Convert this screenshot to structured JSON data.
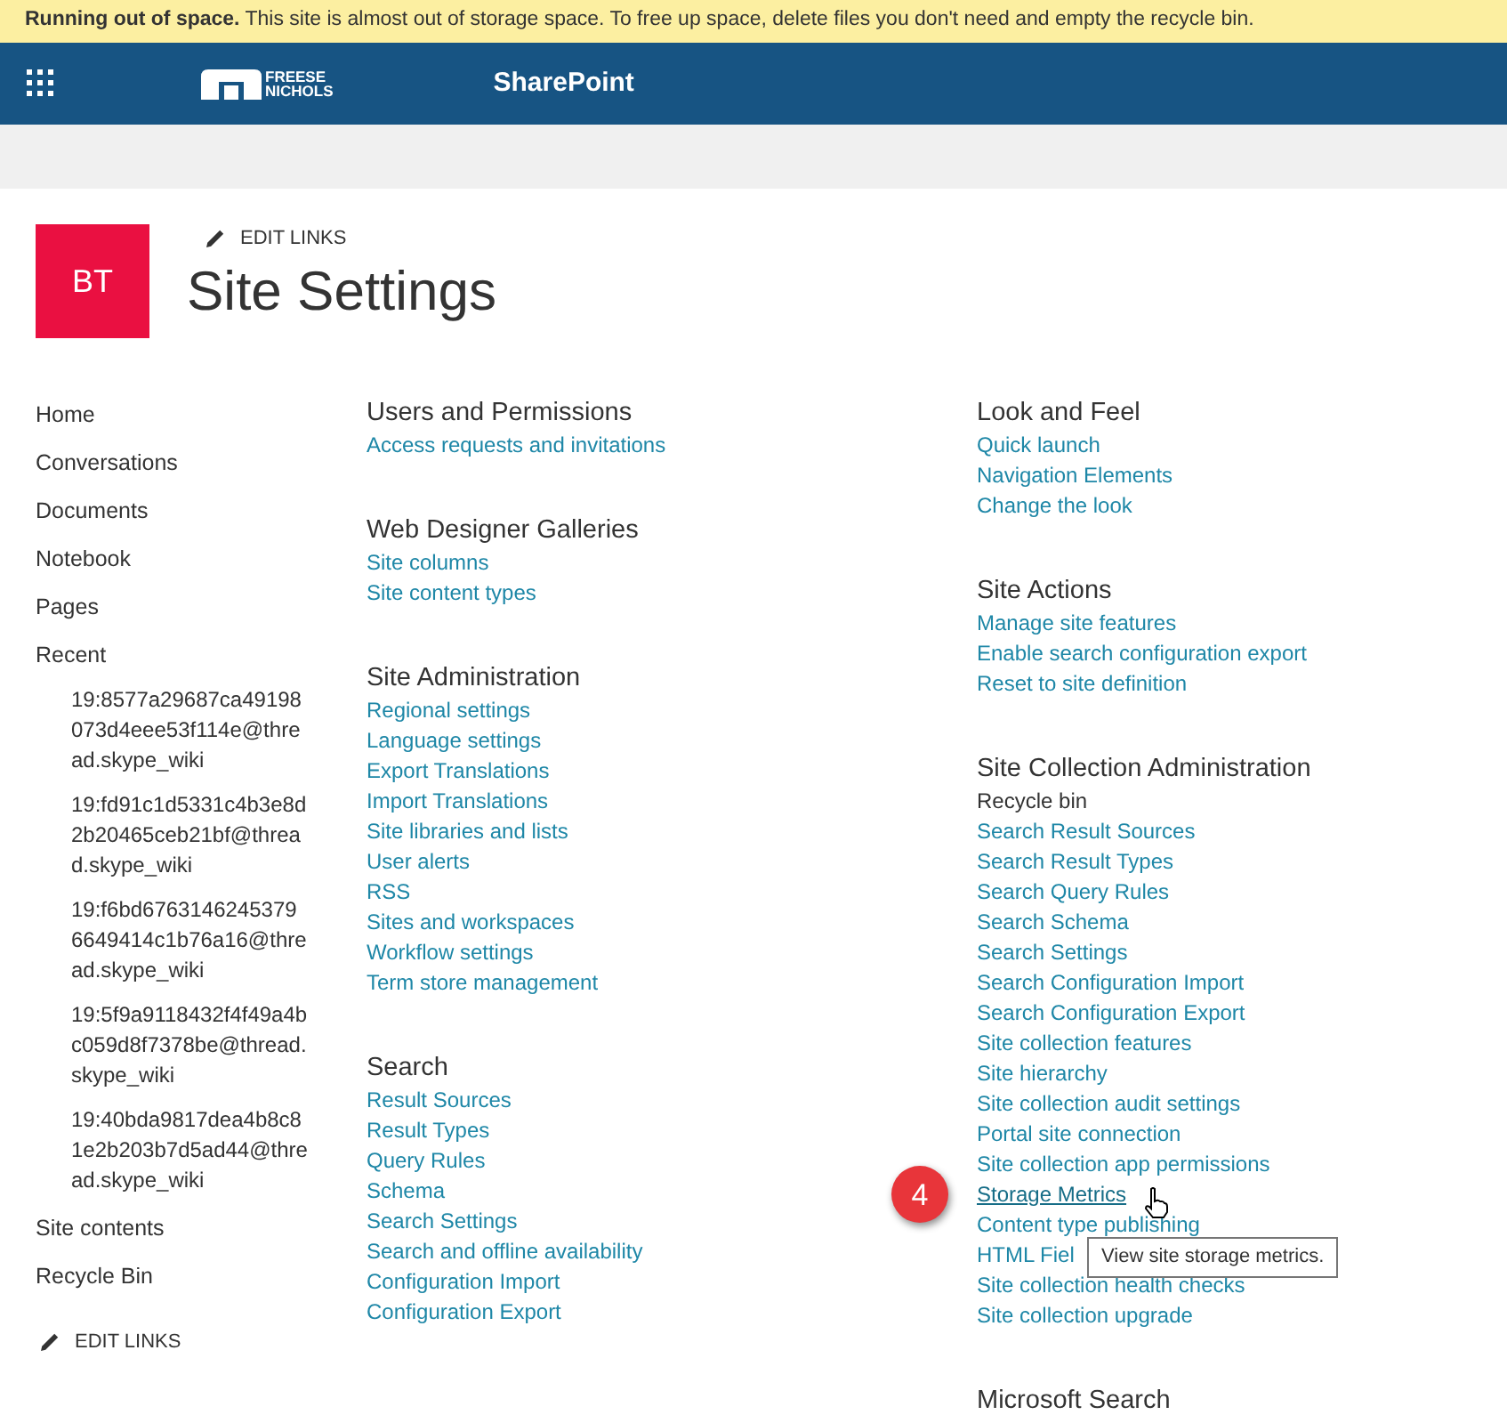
{
  "banner": {
    "title": "Running out of space.",
    "message": "This site is almost out of storage space. To free up space, delete files you don't need and empty the recycle bin."
  },
  "suite_bar": {
    "logo_lines": [
      "FREESE",
      "NICHOLS"
    ],
    "app_name": "SharePoint"
  },
  "header": {
    "site_initials": "BT",
    "edit_links": "EDIT LINKS",
    "title": "Site Settings"
  },
  "nav": {
    "items": [
      {
        "label": "Home"
      },
      {
        "label": "Conversations"
      },
      {
        "label": "Documents"
      },
      {
        "label": "Notebook"
      },
      {
        "label": "Pages"
      },
      {
        "label": "Recent",
        "children": [
          {
            "label": "19:8577a29687ca49198073d4eee53f114e@thread.skype_wiki"
          },
          {
            "label": "19:fd91c1d5331c4b3e8d2b20465ceb21bf@thread.skype_wiki"
          },
          {
            "label": "19:f6bd67631462453796649414c1b76a16@thread.skype_wiki"
          },
          {
            "label": "19:5f9a9118432f4f49a4bc059d8f7378be@thread.skype_wiki"
          },
          {
            "label": "19:40bda9817dea4b8c81e2b203b7d5ad44@thread.skype_wiki"
          }
        ]
      },
      {
        "label": "Site contents"
      },
      {
        "label": "Recycle Bin"
      }
    ],
    "edit_links": "EDIT LINKS"
  },
  "columns": [
    [
      {
        "heading": "Users and Permissions",
        "items": [
          {
            "label": "Access requests and invitations",
            "kind": "link"
          }
        ]
      },
      {
        "heading": "Web Designer Galleries",
        "items": [
          {
            "label": "Site columns",
            "kind": "link"
          },
          {
            "label": "Site content types",
            "kind": "link"
          }
        ]
      },
      {
        "heading": "Site Administration",
        "items": [
          {
            "label": "Regional settings",
            "kind": "link"
          },
          {
            "label": "Language settings",
            "kind": "link"
          },
          {
            "label": "Export Translations",
            "kind": "link"
          },
          {
            "label": "Import Translations",
            "kind": "link"
          },
          {
            "label": "Site libraries and lists",
            "kind": "link"
          },
          {
            "label": "User alerts",
            "kind": "link"
          },
          {
            "label": "RSS",
            "kind": "link"
          },
          {
            "label": "Sites and workspaces",
            "kind": "link"
          },
          {
            "label": "Workflow settings",
            "kind": "link"
          },
          {
            "label": "Term store management",
            "kind": "link"
          }
        ]
      },
      {
        "heading": "Search",
        "items": [
          {
            "label": "Result Sources",
            "kind": "link"
          },
          {
            "label": "Result Types",
            "kind": "link"
          },
          {
            "label": "Query Rules",
            "kind": "link"
          },
          {
            "label": "Schema",
            "kind": "link"
          },
          {
            "label": "Search Settings",
            "kind": "link"
          },
          {
            "label": "Search and offline availability",
            "kind": "link"
          },
          {
            "label": "Configuration Import",
            "kind": "link"
          },
          {
            "label": "Configuration Export",
            "kind": "link"
          }
        ]
      }
    ],
    [
      {
        "heading": "Look and Feel",
        "items": [
          {
            "label": "Quick launch",
            "kind": "link"
          },
          {
            "label": "Navigation Elements",
            "kind": "link"
          },
          {
            "label": "Change the look",
            "kind": "link"
          }
        ]
      },
      {
        "heading": "Site Actions",
        "items": [
          {
            "label": "Manage site features",
            "kind": "link"
          },
          {
            "label": "Enable search configuration export",
            "kind": "link"
          },
          {
            "label": "Reset to site definition",
            "kind": "link"
          }
        ]
      },
      {
        "heading": "Site Collection Administration",
        "items": [
          {
            "label": "Recycle bin",
            "kind": "text",
            "hovered": false
          },
          {
            "label": "Search Result Sources",
            "kind": "link",
            "hovered": false
          },
          {
            "label": "Search Result Types",
            "kind": "link",
            "hovered": false
          },
          {
            "label": "Search Query Rules",
            "kind": "link",
            "hovered": false
          },
          {
            "label": "Search Schema",
            "kind": "link",
            "hovered": false
          },
          {
            "label": "Search Settings",
            "kind": "link",
            "hovered": false
          },
          {
            "label": "Search Configuration Import",
            "kind": "link",
            "hovered": false
          },
          {
            "label": "Search Configuration Export",
            "kind": "link",
            "hovered": false
          },
          {
            "label": "Site collection features",
            "kind": "link",
            "hovered": false
          },
          {
            "label": "Site hierarchy",
            "kind": "link",
            "hovered": false
          },
          {
            "label": "Site collection audit settings",
            "kind": "link",
            "hovered": false
          },
          {
            "label": "Portal site connection",
            "kind": "link",
            "hovered": false
          },
          {
            "label": "Site collection app permissions",
            "kind": "link",
            "hovered": false
          },
          {
            "label": "Storage Metrics",
            "kind": "link",
            "hovered": true,
            "callout": "4",
            "tooltip": "View site storage metrics."
          },
          {
            "label": "Content type publishing",
            "kind": "link",
            "hovered": false
          },
          {
            "label": "HTML Fiel",
            "kind": "link",
            "hovered": false
          },
          {
            "label": "Site collection health checks",
            "kind": "link",
            "hovered": false
          },
          {
            "label": "Site collection upgrade",
            "kind": "link",
            "hovered": false
          }
        ]
      },
      {
        "heading": "Microsoft Search"
      }
    ]
  ]
}
